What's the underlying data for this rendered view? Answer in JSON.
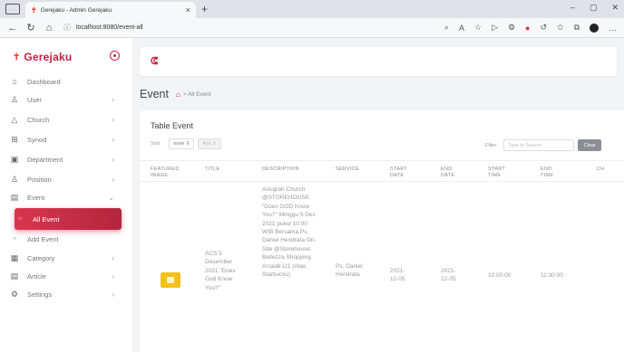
{
  "browser": {
    "tab_title": "Gerejaku - Admin Gerejaku",
    "url": "localhost:8080/event-all"
  },
  "sidebar": {
    "brand": "Gerejaku",
    "items": [
      {
        "label": "Dashboard",
        "icon": "home-icon"
      },
      {
        "label": "User",
        "icon": "user-icon"
      },
      {
        "label": "Church",
        "icon": "triangle-icon"
      },
      {
        "label": "Synod",
        "icon": "building-icon"
      },
      {
        "label": "Department",
        "icon": "department-icon"
      },
      {
        "label": "Position",
        "icon": "position-icon"
      },
      {
        "label": "Event",
        "icon": "calendar-icon"
      },
      {
        "label": "All Event",
        "icon": "dot-icon"
      },
      {
        "label": "Add Event",
        "icon": "dot-icon"
      },
      {
        "label": "Category",
        "icon": "grid-icon"
      },
      {
        "label": "Article",
        "icon": "document-icon"
      },
      {
        "label": "Settings",
        "icon": "gear-icon"
      }
    ]
  },
  "page": {
    "title": "Event",
    "breadcrumb": "All Event"
  },
  "table": {
    "title": "Table Event",
    "sort_label": "Sort",
    "sort_value": "none",
    "order_value": "Asc",
    "filter_label": "Filter",
    "filter_placeholder": "Type to Search",
    "clear_label": "Clear",
    "columns": [
      "FEATURED IMAGE",
      "TITLE",
      "DESCRIPTION",
      "SERVICE",
      "START DATE",
      "END DATE",
      "START TIME",
      "END TIME",
      "CH"
    ],
    "rows": [
      {
        "title": "ACS 5 Desember 2021 \"Does God Know You?\"",
        "description": "Anugrah Church @STOREHOUSE \"Does GOD Know You?\" Minggu 5 Des 2021 pukul 10:00 WIB Bersama Ps. Daniel Hendrata On-Site @Storehouse: Bellezza Shopping Arcade Lt1 (Atas Starbucks)",
        "service": "Ps. Daniel Hendrata",
        "start_date": "2021-12-05",
        "end_date": "2021-12-05",
        "start_time": "10:00:00",
        "end_time": "11:30:00"
      }
    ]
  }
}
